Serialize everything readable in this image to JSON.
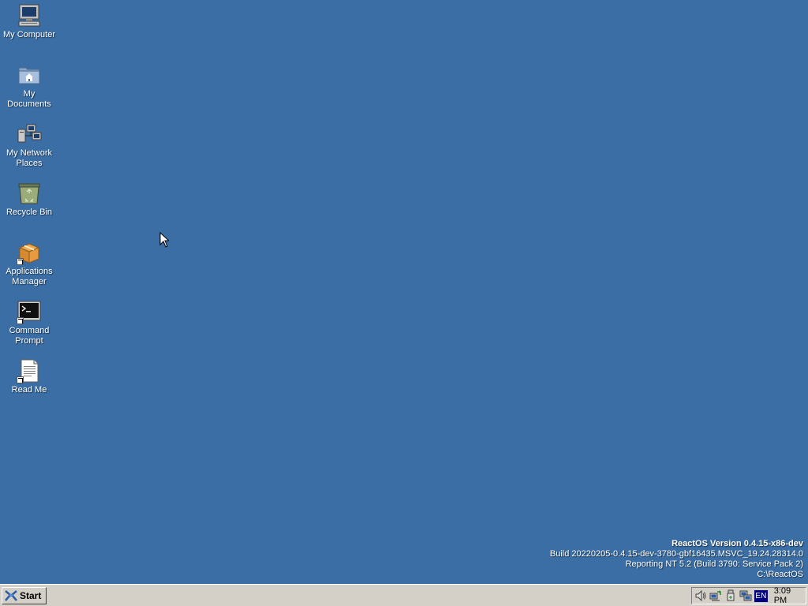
{
  "desktop": {
    "background_color": "#3a6ea5",
    "icons": [
      {
        "name": "my-computer",
        "label": "My Computer",
        "icon": "computer-icon"
      },
      {
        "name": "my-documents",
        "label": "My Documents",
        "icon": "folder-home-icon"
      },
      {
        "name": "my-network-places",
        "label": "My Network Places",
        "icon": "network-icon"
      },
      {
        "name": "recycle-bin",
        "label": "Recycle Bin",
        "icon": "recycle-bin-icon"
      },
      {
        "name": "applications-manager",
        "label": "Applications Manager",
        "icon": "package-icon"
      },
      {
        "name": "command-prompt",
        "label": "Command Prompt",
        "icon": "console-icon"
      },
      {
        "name": "read-me",
        "label": "Read Me",
        "icon": "document-icon"
      }
    ]
  },
  "version_info": {
    "line1": "ReactOS Version 0.4.15-x86-dev",
    "line2": "Build 20220205-0.4.15-dev-3780-gbf16435.MSVC_19.24.28314.0",
    "line3": "Reporting NT 5.2 (Build 3790: Service Pack 2)",
    "line4": "C:\\ReactOS"
  },
  "taskbar": {
    "start_label": "Start",
    "tray": {
      "icons": [
        "volume-icon",
        "network-connection-icon",
        "safely-remove-hardware-icon",
        "display-icon"
      ],
      "language": "EN",
      "clock": "3:09 PM"
    }
  }
}
